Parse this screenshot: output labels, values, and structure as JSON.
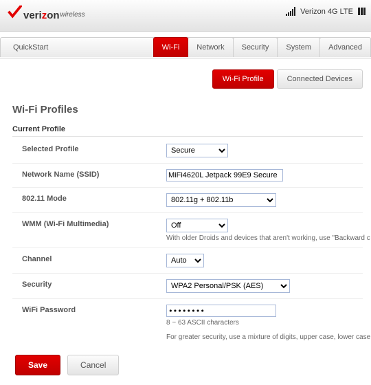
{
  "header": {
    "brand_pre": "veri",
    "brand_z": "z",
    "brand_post": "on",
    "brand_sub": "wireless",
    "network_status": "Verizon 4G LTE"
  },
  "tabs": {
    "quickstart": "QuickStart",
    "main": [
      "Wi-Fi",
      "Network",
      "Security",
      "System",
      "Advanced"
    ],
    "main_active_index": 0,
    "sub": [
      "Wi-Fi Profile",
      "Connected Devices"
    ],
    "sub_active_index": 0
  },
  "page": {
    "title": "Wi-Fi Profiles",
    "section": "Current Profile"
  },
  "fields": {
    "selected_profile": {
      "label": "Selected Profile",
      "value": "Secure"
    },
    "ssid": {
      "label": "Network Name (SSID)",
      "value": "MiFi4620L Jetpack 99E9 Secure"
    },
    "mode": {
      "label": "802.11 Mode",
      "value": "802.11g + 802.11b"
    },
    "wmm": {
      "label": "WMM (Wi-Fi Multimedia)",
      "value": "Off",
      "hint": "With older Droids and devices that aren't working, use \"Backward c"
    },
    "channel": {
      "label": "Channel",
      "value": "Auto"
    },
    "security": {
      "label": "Security",
      "value": "WPA2 Personal/PSK (AES)"
    },
    "password": {
      "label": "WiFi Password",
      "value": "••••••••",
      "hint1": "8 ~ 63 ASCII characters",
      "hint2": "For greater security, use a mixture of digits, upper case, lower case"
    }
  },
  "buttons": {
    "save": "Save",
    "cancel": "Cancel"
  }
}
